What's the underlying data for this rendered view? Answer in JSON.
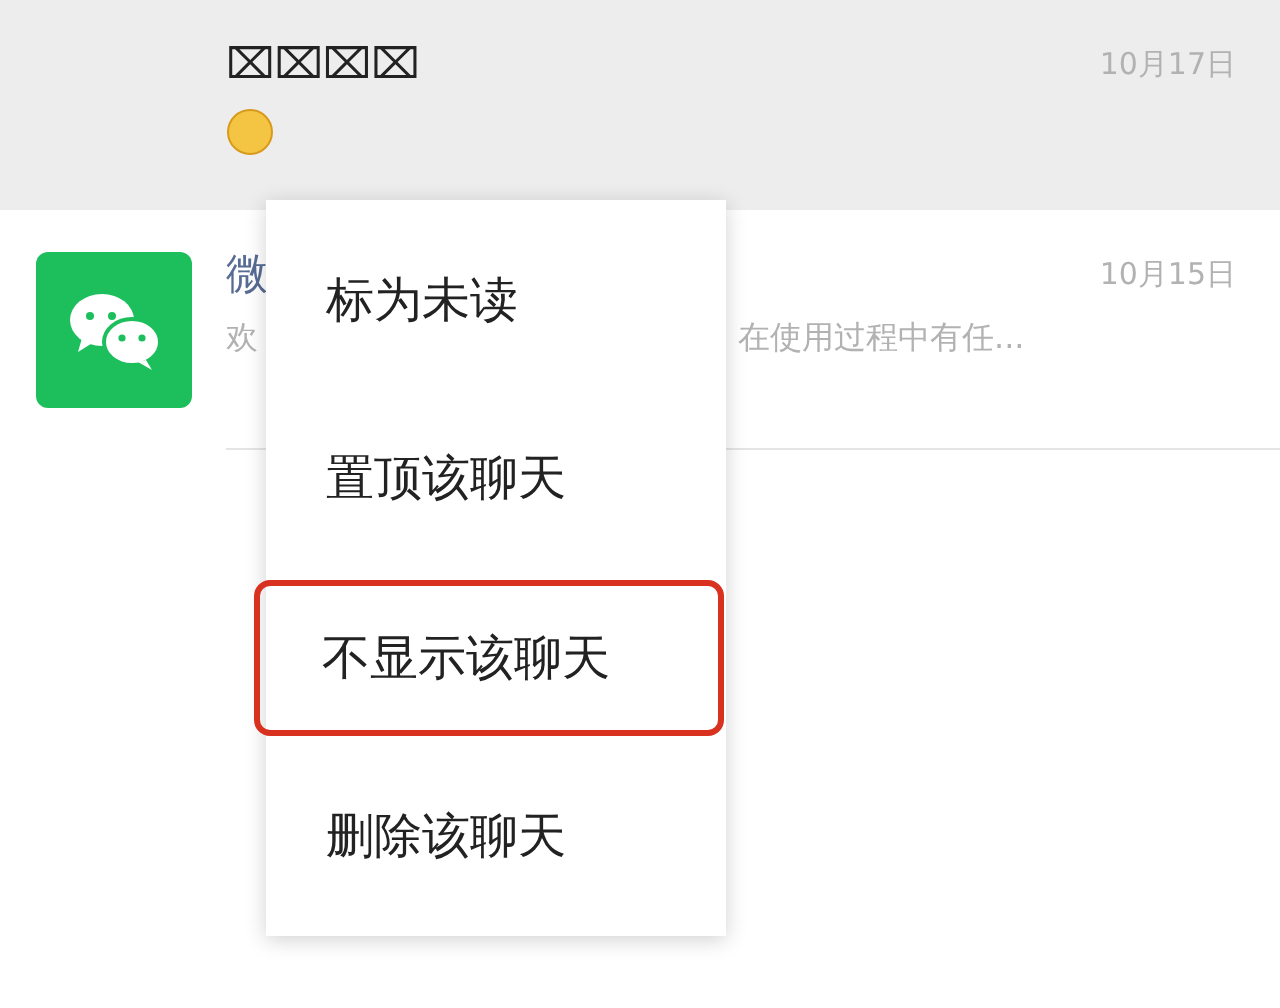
{
  "chats": [
    {
      "name": "⌧⌧⌧⌧",
      "kind": "emoji",
      "date": "10月17日",
      "pressed": true
    },
    {
      "name": "微",
      "preview_start": "欢",
      "preview_end": "在使用过程中有任...",
      "kind": "text",
      "date": "10月15日",
      "pressed": false
    }
  ],
  "menu": {
    "items": [
      {
        "label": "标为未读",
        "highlighted": false
      },
      {
        "label": "置顶该聊天",
        "highlighted": false
      },
      {
        "label": "不显示该聊天",
        "highlighted": true
      },
      {
        "label": "删除该聊天",
        "highlighted": false
      }
    ]
  }
}
